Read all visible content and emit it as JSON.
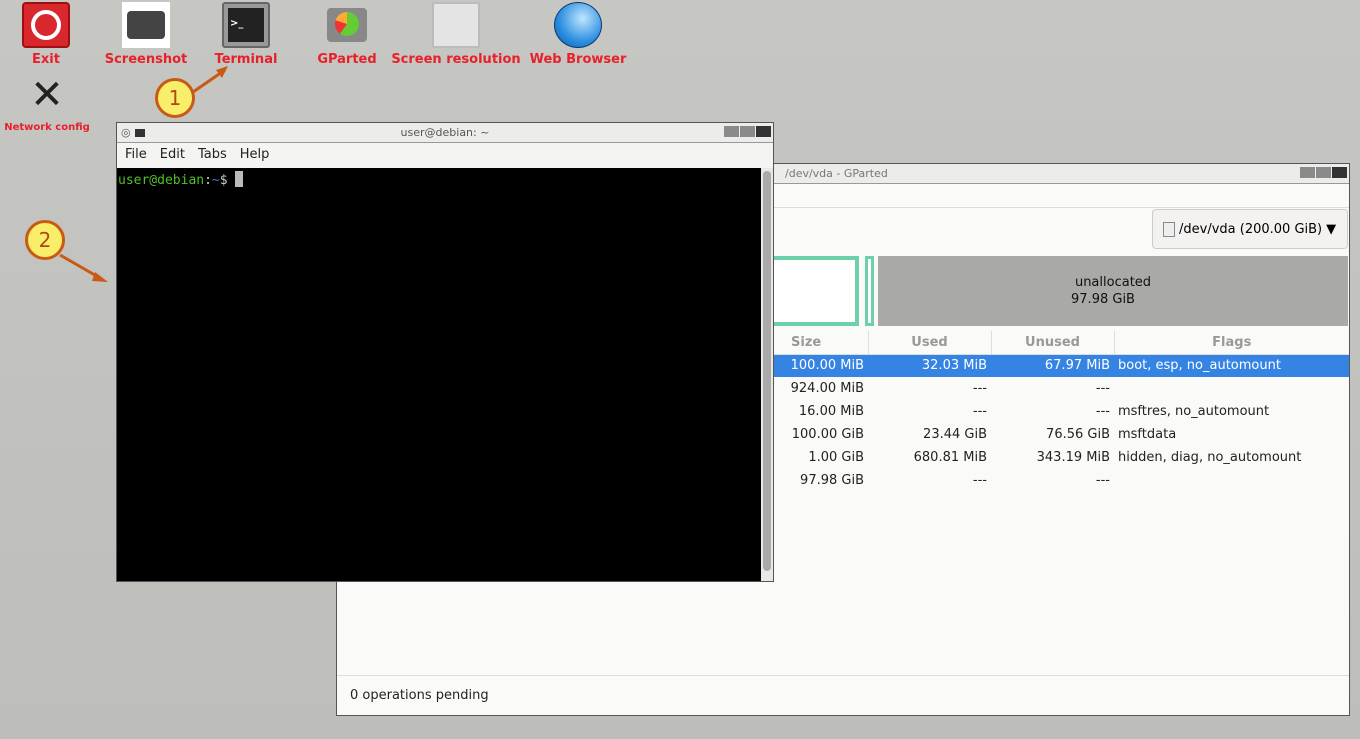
{
  "desktop": {
    "icons": [
      {
        "label": "Exit",
        "icon": "power-icon"
      },
      {
        "label": "Screenshot",
        "icon": "camera-icon"
      },
      {
        "label": "Terminal",
        "icon": "terminal-icon"
      },
      {
        "label": "GParted",
        "icon": "disk-icon"
      },
      {
        "label": "Screen resolution",
        "icon": "monitor-icon"
      },
      {
        "label": "Web Browser",
        "icon": "globe-icon"
      },
      {
        "label": "Network config",
        "icon": "tools-icon"
      }
    ]
  },
  "callouts": [
    "1",
    "2"
  ],
  "terminal": {
    "title": "user@debian: ~",
    "menu": [
      "File",
      "Edit",
      "Tabs",
      "Help"
    ],
    "prompt_user": "user@debian",
    "prompt_sep": ":",
    "prompt_path": "~",
    "prompt_symbol": "$"
  },
  "gparted": {
    "title": "/dev/vda - GParted",
    "device": "/dev/vda (200.00 GiB)",
    "unallocated_label": "unallocated",
    "unallocated_size": "97.98 GiB",
    "columns": [
      "Size",
      "Used",
      "Unused",
      "Flags"
    ],
    "rows": [
      [
        "100.00 MiB",
        "32.03 MiB",
        "67.97 MiB",
        "boot, esp, no_automount"
      ],
      [
        "924.00 MiB",
        "---",
        "---",
        ""
      ],
      [
        "16.00 MiB",
        "---",
        "---",
        "msftres, no_automount"
      ],
      [
        "100.00 GiB",
        "23.44 GiB",
        "76.56 GiB",
        "msftdata"
      ],
      [
        "1.00 GiB",
        "680.81 MiB",
        "343.19 MiB",
        "hidden, diag, no_automount"
      ],
      [
        "97.98 GiB",
        "---",
        "---",
        ""
      ]
    ],
    "selected_row": 0,
    "status": "0 operations pending"
  },
  "colors": {
    "selection": "#3584e4",
    "partition_border": "#6cd0a8",
    "unallocated": "#a9aaa6",
    "icon_label": "#e8202a"
  }
}
